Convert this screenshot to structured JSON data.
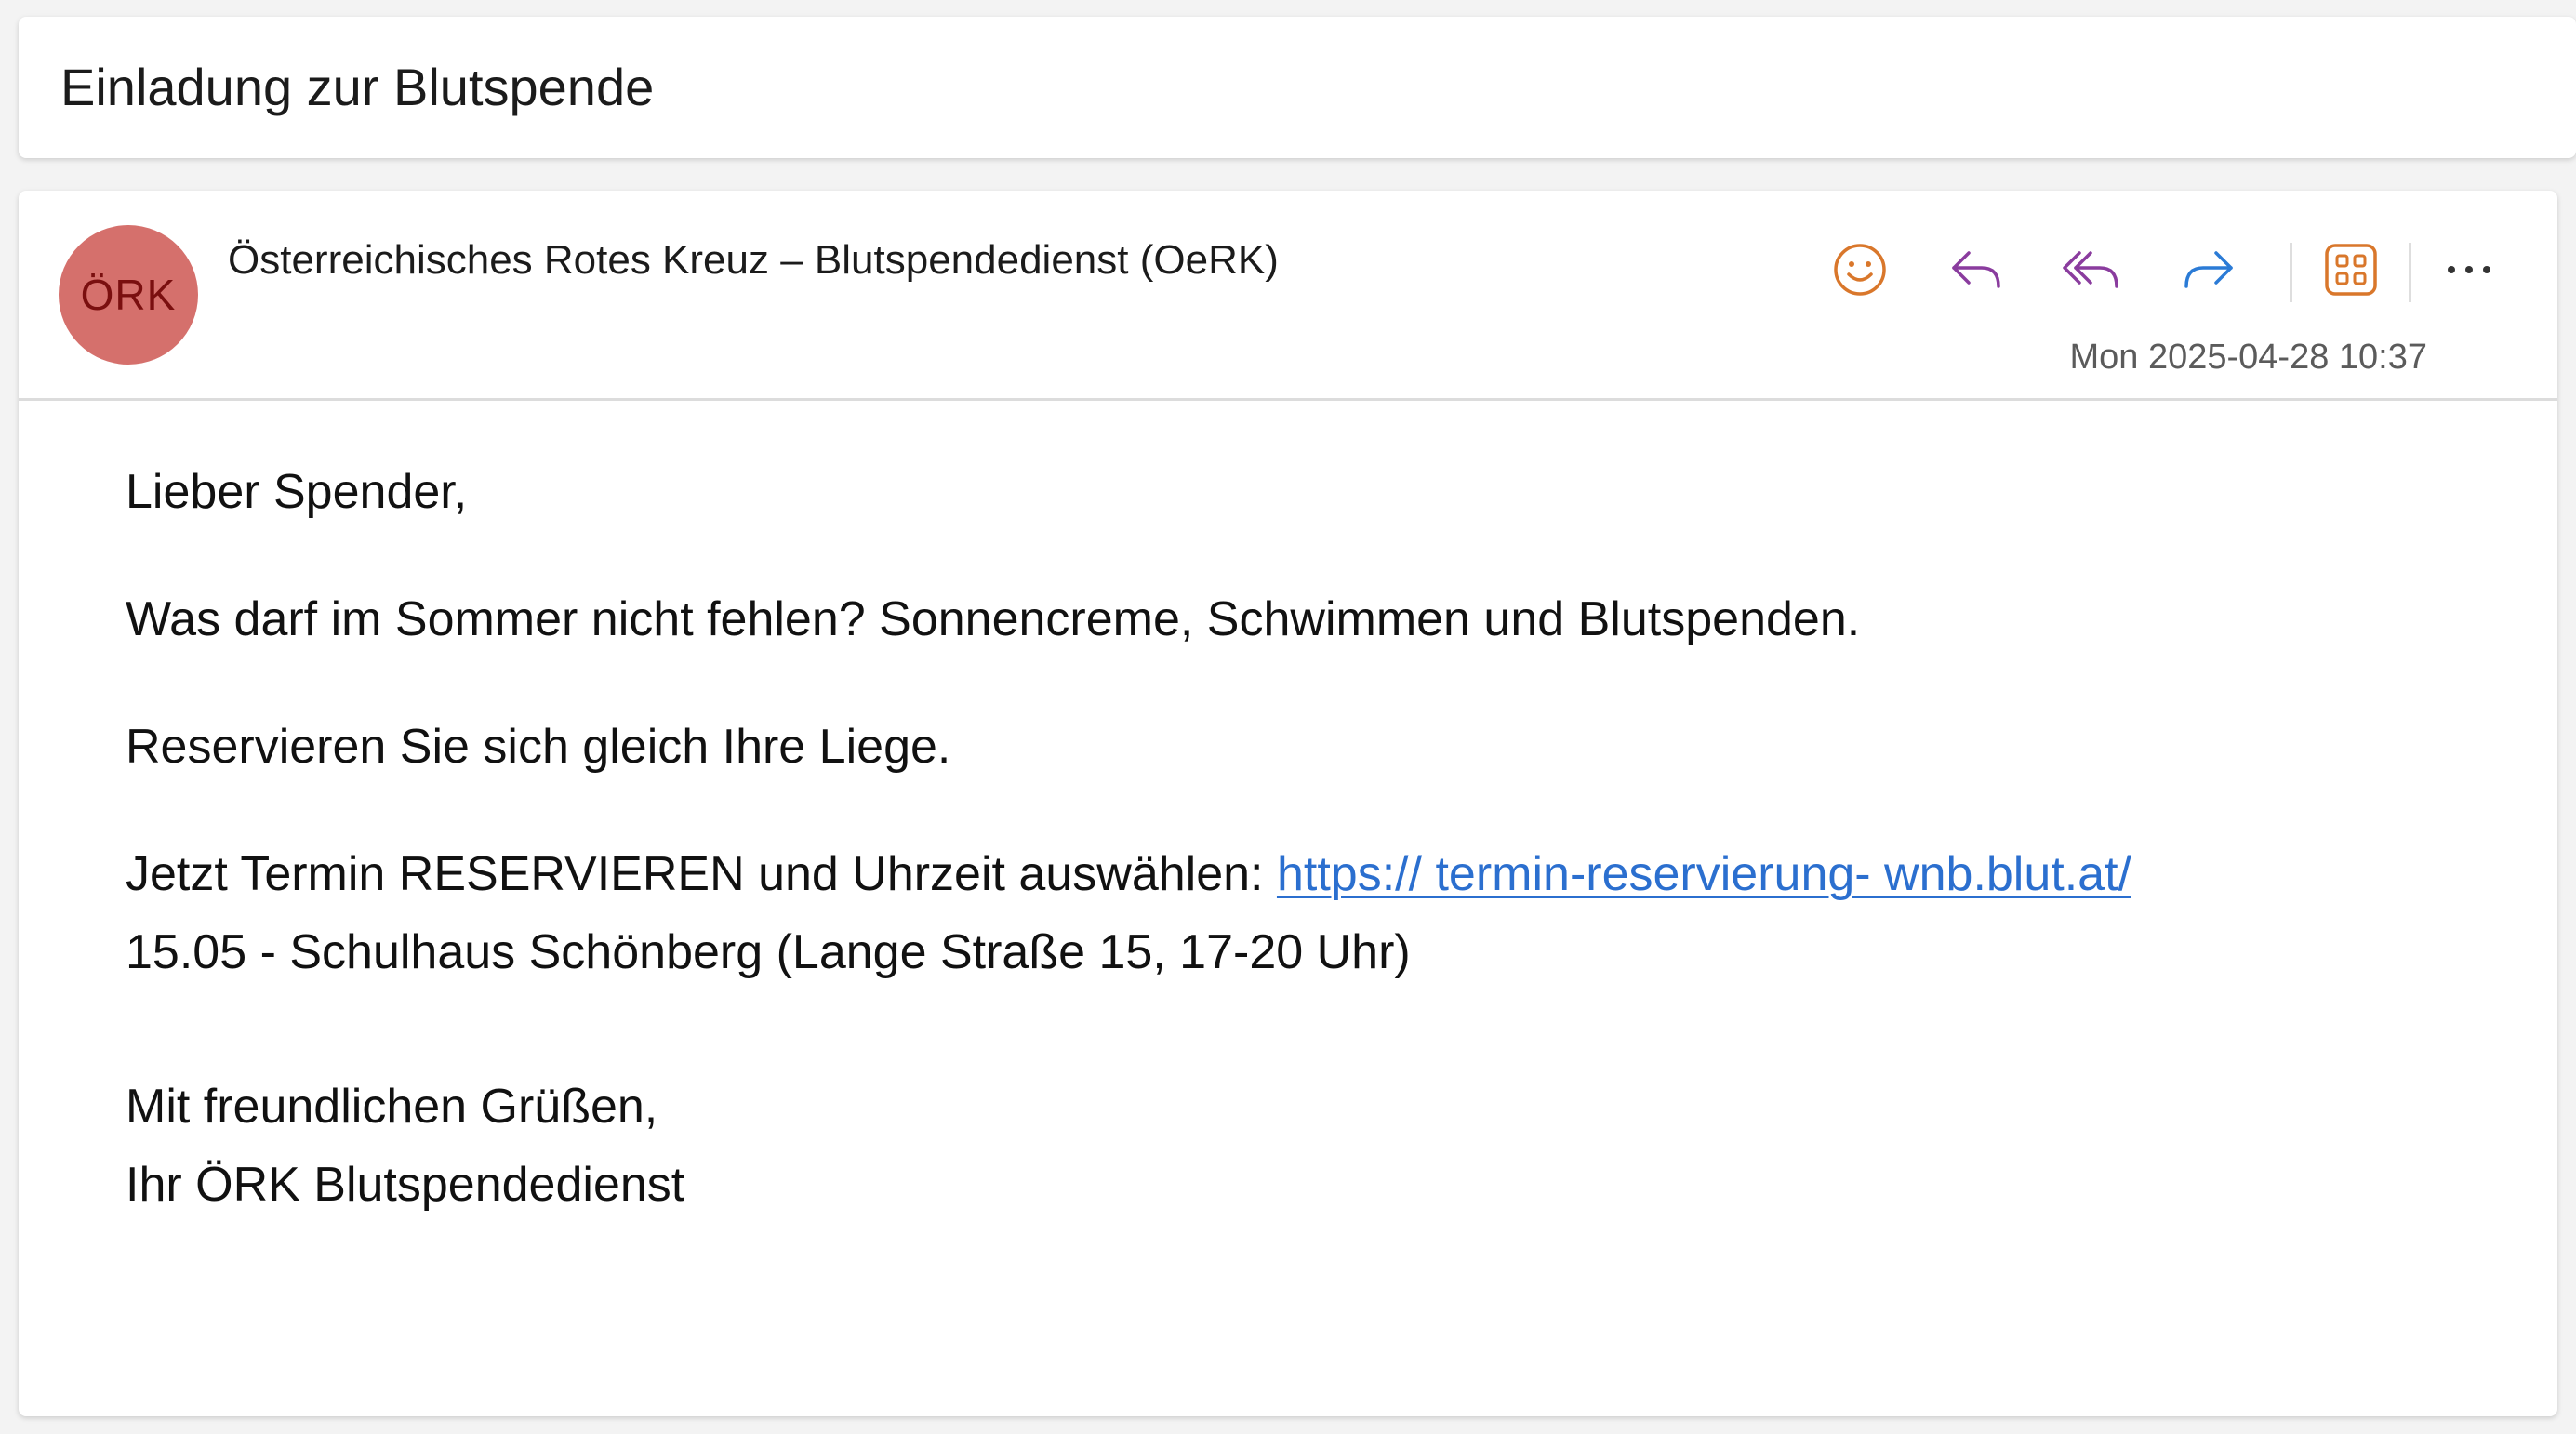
{
  "subject": "Einladung zur Blutspende",
  "sender": {
    "avatar_initials": "ÖRK",
    "avatar_color": "#d5706c",
    "name": "Österreichisches Rotes Kreuz – Blutspendedienst (OeRK)"
  },
  "timestamp": "Mon 2025-04-28 10:37",
  "toolbar": {
    "icons": [
      "smiley-icon",
      "reply-icon",
      "reply-all-icon",
      "forward-icon",
      "apps-grid-icon",
      "more-icon"
    ],
    "colors": {
      "smiley": "#d9772b",
      "reply": "#8a3c9e",
      "reply_all": "#8a3c9e",
      "forward": "#2b7bd6",
      "apps": "#d9772b",
      "more": "#333333"
    }
  },
  "body": {
    "greeting": "Lieber Spender,",
    "line1": "Was darf im Sommer nicht fehlen? Sonnencreme, Schwimmen und Blutspenden.",
    "line2": "Reservieren Sie sich gleich Ihre Liege.",
    "cta_prefix": "Jetzt Termin RESERVIEREN und Uhrzeit auswählen: ",
    "cta_link": "https:// termin-reservierung- wnb.blut.at/",
    "event": "15.05 - Schulhaus Schönberg (Lange Straße 15, 17-20 Uhr)",
    "closing": "Mit freundlichen Grüßen,",
    "signature": "Ihr ÖRK Blutspendedienst"
  },
  "link_color": "#2b6fcf"
}
